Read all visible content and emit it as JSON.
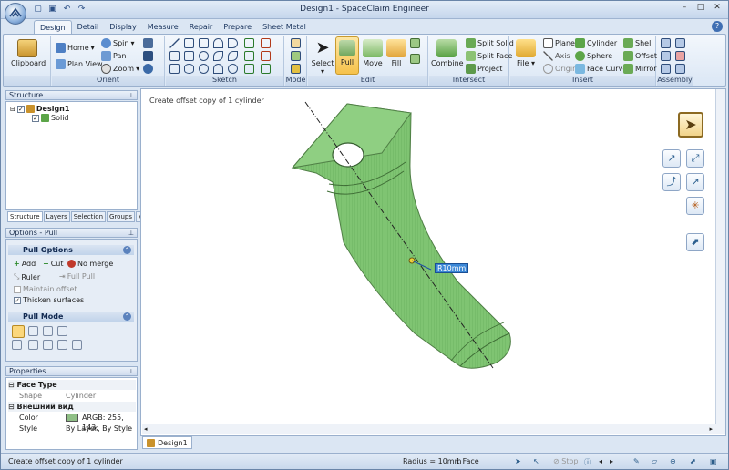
{
  "window": {
    "title": "Design1 - SpaceClaim Engineer"
  },
  "tabs": [
    {
      "label": "Design",
      "active": true
    },
    {
      "label": "Detail"
    },
    {
      "label": "Display"
    },
    {
      "label": "Measure"
    },
    {
      "label": "Repair"
    },
    {
      "label": "Prepare"
    },
    {
      "label": "Sheet Metal"
    }
  ],
  "ribbon": {
    "clipboard": {
      "label": "Clipboard"
    },
    "orient": {
      "label": "Orient",
      "home": "Home",
      "plan_view": "Plan View",
      "spin": "Spin",
      "pan": "Pan",
      "zoom": "Zoom"
    },
    "sketch": {
      "label": "Sketch"
    },
    "mode": {
      "label": "Mode"
    },
    "edit": {
      "label": "Edit",
      "select": "Select",
      "pull": "Pull",
      "move": "Move",
      "fill": "Fill"
    },
    "intersect": {
      "label": "Intersect",
      "combine": "Combine",
      "split_solid": "Split Solid",
      "split_face": "Split Face",
      "project": "Project"
    },
    "insert": {
      "label": "Insert",
      "file": "File",
      "plane": "Plane",
      "axis": "Axis",
      "origin": "Origin",
      "cylinder": "Cylinder",
      "sphere": "Sphere",
      "face_curve": "Face Curve",
      "shell": "Shell",
      "offset": "Offset",
      "mirror": "Mirror"
    },
    "assembly": {
      "label": "Assembly"
    }
  },
  "structure": {
    "header": "Structure",
    "root": "Design1",
    "child": "Solid",
    "tabs": [
      "Structure",
      "Layers",
      "Selection",
      "Groups",
      "Views"
    ]
  },
  "options": {
    "header": "Options - Pull",
    "pull_options": "Pull Options",
    "add": "Add",
    "cut": "Cut",
    "no_merge": "No merge",
    "ruler": "Ruler",
    "full_pull": "Full Pull",
    "maintain_offset": "Maintain offset",
    "thicken_surfaces": "Thicken surfaces",
    "pull_mode": "Pull Mode"
  },
  "properties": {
    "header": "Properties",
    "face_type": "Face Type",
    "shape_label": "Shape",
    "shape_value": "Cylinder",
    "appearance": "Внешний вид",
    "color_label": "Color",
    "color_value": "ARGB: 255, 143,",
    "color_hex": "#8fbf86",
    "style_label": "Style",
    "style_value": "By Layer, By Style"
  },
  "canvas": {
    "hint": "Create offset copy of 1 cylinder",
    "dimension": "R10mm",
    "model_color": "#7fc472"
  },
  "document_tab": "Design1",
  "status": {
    "message": "Create offset copy of 1 cylinder",
    "radius": "Radius = 10mm",
    "selection": "1 Face",
    "stop": "Stop"
  }
}
